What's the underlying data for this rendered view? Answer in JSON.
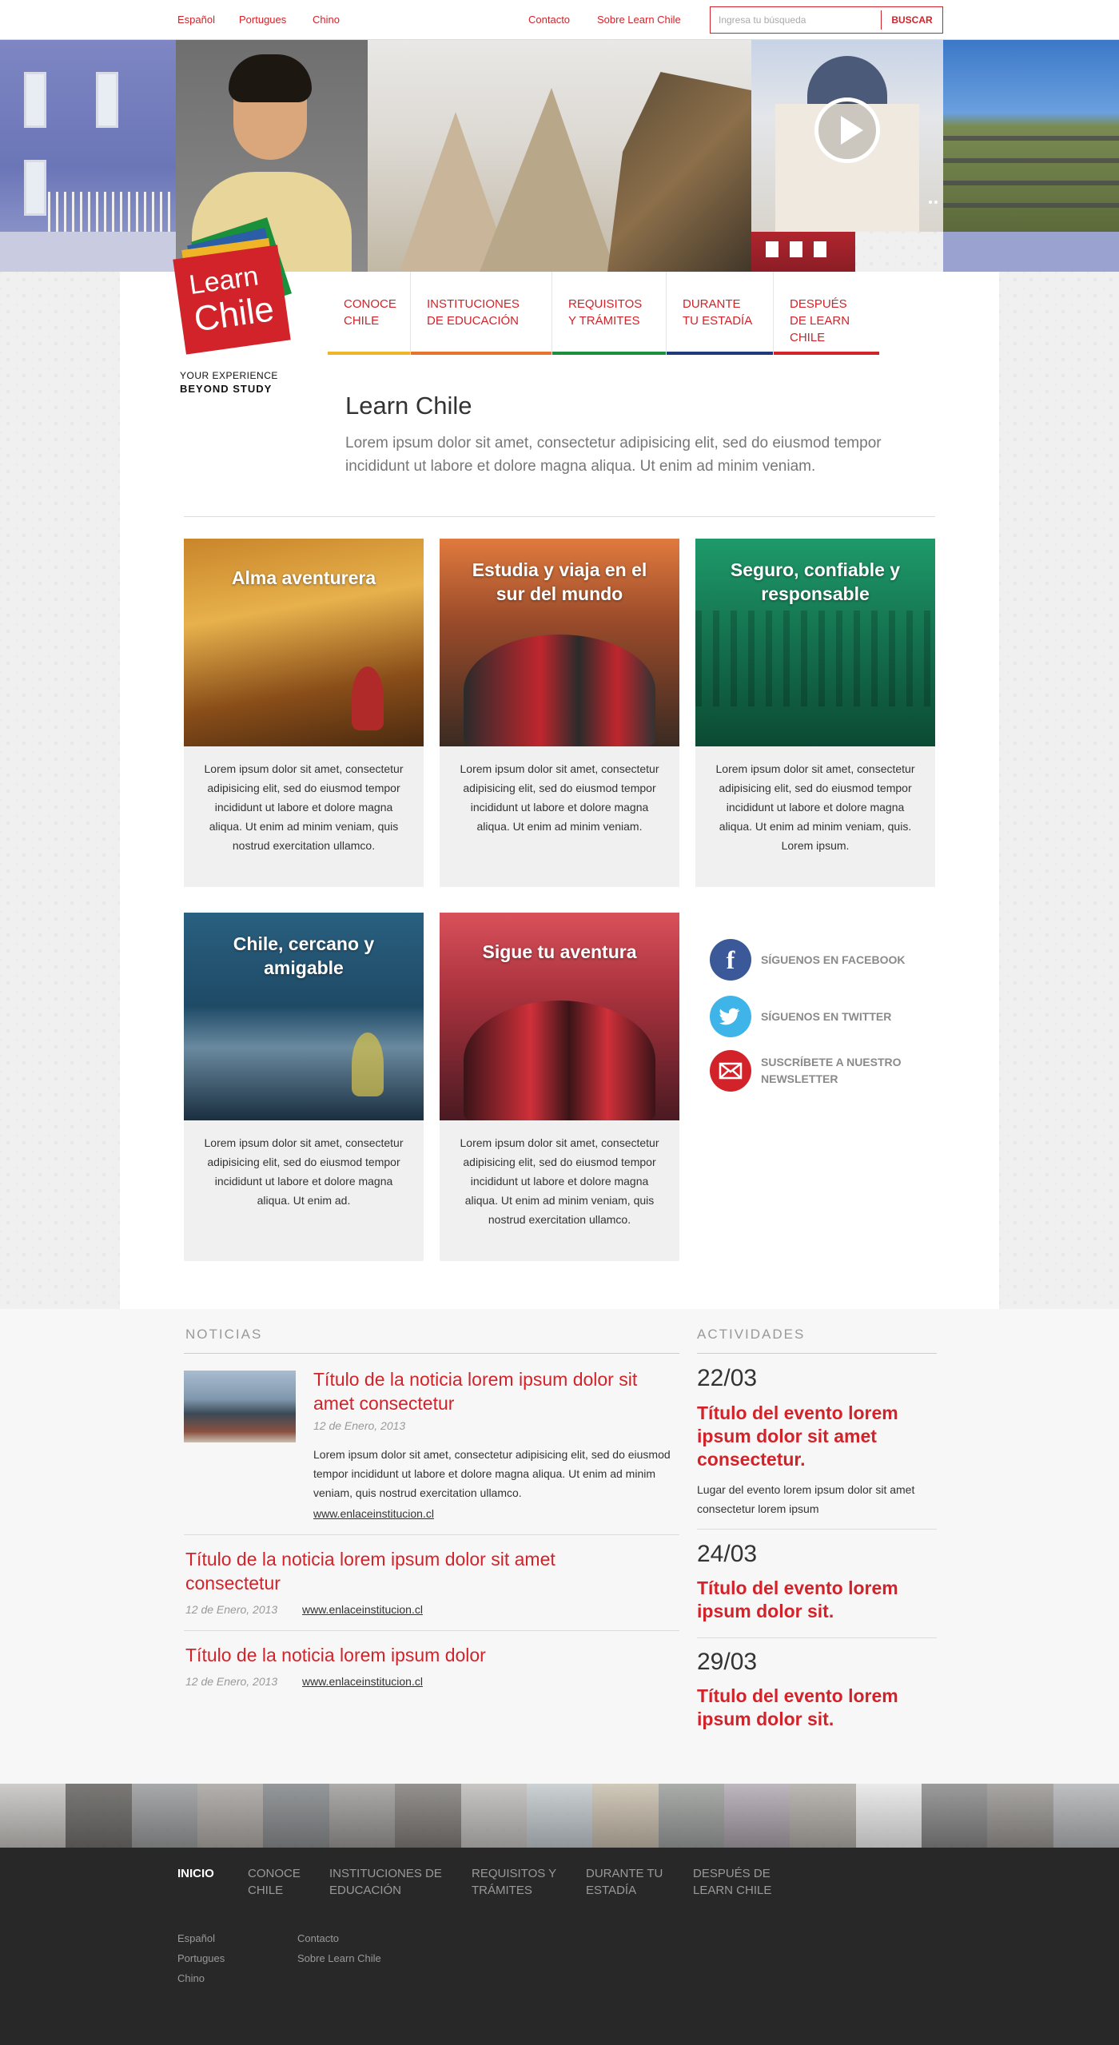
{
  "topbar": {
    "languages": [
      "Español",
      "Portugues",
      "Chino"
    ],
    "links": [
      "Contacto",
      "Sobre Learn Chile"
    ],
    "search_placeholder": "Ingresa tu búsqueda",
    "search_button": "BUSCAR"
  },
  "logo": {
    "line1": "Learn",
    "line2": "Chile",
    "tagline1": "YOUR EXPERIENCE",
    "tagline2": "BEYOND STUDY"
  },
  "nav": [
    {
      "label": "CONOCE CHILE",
      "color": "#f0b428"
    },
    {
      "label": "INSTITUCIONES DE EDUCACIÓN",
      "color": "#e8732c"
    },
    {
      "label": "REQUISITOS Y TRÁMITES",
      "color": "#1a8f3c"
    },
    {
      "label": "DURANTE TU ESTADÍA",
      "color": "#1f3a7a"
    },
    {
      "label": "DESPUÉS DE LEARN CHILE",
      "color": "#d2232a"
    }
  ],
  "intro": {
    "title": "Learn Chile",
    "text": "Lorem ipsum dolor sit amet, consectetur adipisicing elit, sed do eiusmod tempor incididunt ut labore et dolore magna aliqua. Ut enim ad minim veniam."
  },
  "cards": [
    {
      "title": "Alma aventurera",
      "text": "Lorem ipsum dolor sit amet, consectetur adipisicing elit, sed do eiusmod tempor incididunt ut labore et dolore magna aliqua. Ut enim ad minim veniam, quis nostrud exercitation ullamco."
    },
    {
      "title": "Estudia y viaja en el sur del mundo",
      "text": "Lorem ipsum dolor sit amet, consectetur adipisicing elit, sed do eiusmod tempor incididunt ut labore et dolore magna aliqua. Ut enim ad minim veniam."
    },
    {
      "title": "Seguro, confiable y responsable",
      "text": "Lorem ipsum dolor sit amet, consectetur adipisicing elit, sed do eiusmod tempor incididunt ut labore et dolore magna aliqua. Ut enim ad minim veniam, quis. Lorem ipsum."
    },
    {
      "title": "Chile, cercano y amigable",
      "text": "Lorem ipsum dolor sit amet, consectetur adipisicing elit, sed do eiusmod tempor incididunt ut labore et dolore magna aliqua. Ut enim ad."
    },
    {
      "title": "Sigue tu aventura",
      "text": "Lorem ipsum dolor sit amet, consectetur adipisicing elit, sed do eiusmod tempor incididunt ut labore et dolore magna aliqua. Ut enim ad minim veniam, quis nostrud exercitation ullamco."
    }
  ],
  "social": [
    {
      "label": "SÍGUENOS EN FACEBOOK",
      "icon": "facebook-icon",
      "color": "#3b5998"
    },
    {
      "label": "SÍGUENOS EN TWITTER",
      "icon": "twitter-icon",
      "color": "#3fb4e8"
    },
    {
      "label": "SUSCRÍBETE A NUESTRO NEWSLETTER",
      "icon": "mail-icon",
      "color": "#d2232a"
    }
  ],
  "news": {
    "heading": "NOTICIAS",
    "items": [
      {
        "title": "Título de la noticia lorem ipsum dolor sit amet consectetur",
        "date": "12 de Enero, 2013",
        "text": "Lorem ipsum dolor sit amet, consectetur adipisicing elit, sed do eiusmod tempor incididunt ut labore et dolore magna aliqua. Ut enim ad minim veniam, quis nostrud exercitation ullamco.",
        "link": "www.enlaceinstitucion.cl"
      },
      {
        "title": "Título de la noticia lorem ipsum dolor sit amet consectetur",
        "date": "12 de Enero, 2013",
        "link": "www.enlaceinstitucion.cl"
      },
      {
        "title": "Título de la noticia lorem ipsum dolor",
        "date": "12 de Enero, 2013",
        "link": "www.enlaceinstitucion.cl"
      }
    ]
  },
  "activities": {
    "heading": "ACTIVIDADES",
    "items": [
      {
        "date": "22/03",
        "title": "Título del evento lorem ipsum dolor sit amet consectetur.",
        "place": "Lugar del evento lorem ipsum dolor sit amet consectetur lorem ipsum"
      },
      {
        "date": "24/03",
        "title": "Título del evento lorem ipsum dolor sit."
      },
      {
        "date": "29/03",
        "title": "Título del evento lorem ipsum dolor sit."
      }
    ]
  },
  "footer": {
    "nav": [
      "INICIO",
      "CONOCE CHILE",
      "INSTITUCIONES DE EDUCACIÓN",
      "REQUISITOS Y TRÁMITES",
      "DURANTE TU ESTADÍA",
      "DESPUÉS DE LEARN CHILE"
    ],
    "languages": [
      "Español",
      "Portugues",
      "Chino"
    ],
    "links": [
      "Contacto",
      "Sobre Learn Chile"
    ]
  },
  "colors": {
    "accent": "#d2232a",
    "footer_bg": "#282828"
  }
}
